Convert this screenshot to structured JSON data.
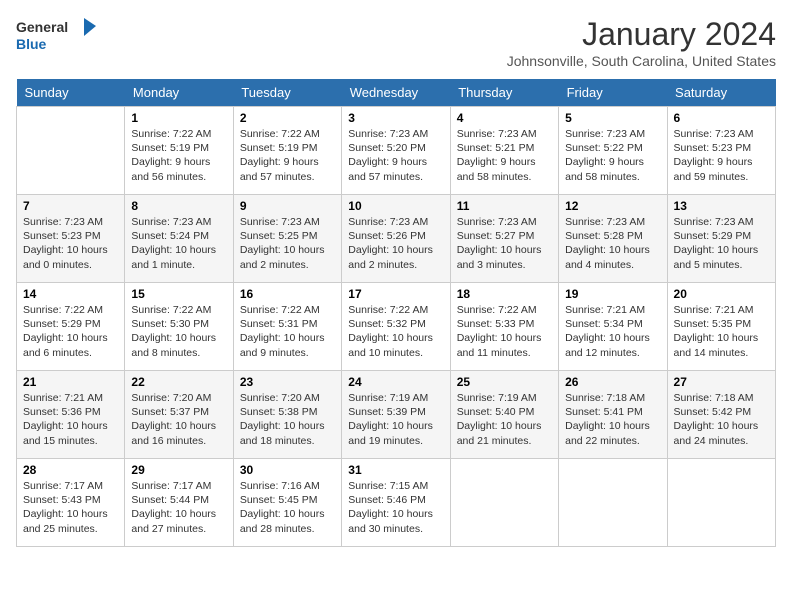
{
  "header": {
    "logo_line1": "General",
    "logo_line2": "Blue",
    "month_title": "January 2024",
    "location": "Johnsonville, South Carolina, United States"
  },
  "weekdays": [
    "Sunday",
    "Monday",
    "Tuesday",
    "Wednesday",
    "Thursday",
    "Friday",
    "Saturday"
  ],
  "weeks": [
    [
      {
        "day": "",
        "sunrise": "",
        "sunset": "",
        "daylight": ""
      },
      {
        "day": "1",
        "sunrise": "Sunrise: 7:22 AM",
        "sunset": "Sunset: 5:19 PM",
        "daylight": "Daylight: 9 hours and 56 minutes."
      },
      {
        "day": "2",
        "sunrise": "Sunrise: 7:22 AM",
        "sunset": "Sunset: 5:19 PM",
        "daylight": "Daylight: 9 hours and 57 minutes."
      },
      {
        "day": "3",
        "sunrise": "Sunrise: 7:23 AM",
        "sunset": "Sunset: 5:20 PM",
        "daylight": "Daylight: 9 hours and 57 minutes."
      },
      {
        "day": "4",
        "sunrise": "Sunrise: 7:23 AM",
        "sunset": "Sunset: 5:21 PM",
        "daylight": "Daylight: 9 hours and 58 minutes."
      },
      {
        "day": "5",
        "sunrise": "Sunrise: 7:23 AM",
        "sunset": "Sunset: 5:22 PM",
        "daylight": "Daylight: 9 hours and 58 minutes."
      },
      {
        "day": "6",
        "sunrise": "Sunrise: 7:23 AM",
        "sunset": "Sunset: 5:23 PM",
        "daylight": "Daylight: 9 hours and 59 minutes."
      }
    ],
    [
      {
        "day": "7",
        "sunrise": "Sunrise: 7:23 AM",
        "sunset": "Sunset: 5:23 PM",
        "daylight": "Daylight: 10 hours and 0 minutes."
      },
      {
        "day": "8",
        "sunrise": "Sunrise: 7:23 AM",
        "sunset": "Sunset: 5:24 PM",
        "daylight": "Daylight: 10 hours and 1 minute."
      },
      {
        "day": "9",
        "sunrise": "Sunrise: 7:23 AM",
        "sunset": "Sunset: 5:25 PM",
        "daylight": "Daylight: 10 hours and 2 minutes."
      },
      {
        "day": "10",
        "sunrise": "Sunrise: 7:23 AM",
        "sunset": "Sunset: 5:26 PM",
        "daylight": "Daylight: 10 hours and 2 minutes."
      },
      {
        "day": "11",
        "sunrise": "Sunrise: 7:23 AM",
        "sunset": "Sunset: 5:27 PM",
        "daylight": "Daylight: 10 hours and 3 minutes."
      },
      {
        "day": "12",
        "sunrise": "Sunrise: 7:23 AM",
        "sunset": "Sunset: 5:28 PM",
        "daylight": "Daylight: 10 hours and 4 minutes."
      },
      {
        "day": "13",
        "sunrise": "Sunrise: 7:23 AM",
        "sunset": "Sunset: 5:29 PM",
        "daylight": "Daylight: 10 hours and 5 minutes."
      }
    ],
    [
      {
        "day": "14",
        "sunrise": "Sunrise: 7:22 AM",
        "sunset": "Sunset: 5:29 PM",
        "daylight": "Daylight: 10 hours and 6 minutes."
      },
      {
        "day": "15",
        "sunrise": "Sunrise: 7:22 AM",
        "sunset": "Sunset: 5:30 PM",
        "daylight": "Daylight: 10 hours and 8 minutes."
      },
      {
        "day": "16",
        "sunrise": "Sunrise: 7:22 AM",
        "sunset": "Sunset: 5:31 PM",
        "daylight": "Daylight: 10 hours and 9 minutes."
      },
      {
        "day": "17",
        "sunrise": "Sunrise: 7:22 AM",
        "sunset": "Sunset: 5:32 PM",
        "daylight": "Daylight: 10 hours and 10 minutes."
      },
      {
        "day": "18",
        "sunrise": "Sunrise: 7:22 AM",
        "sunset": "Sunset: 5:33 PM",
        "daylight": "Daylight: 10 hours and 11 minutes."
      },
      {
        "day": "19",
        "sunrise": "Sunrise: 7:21 AM",
        "sunset": "Sunset: 5:34 PM",
        "daylight": "Daylight: 10 hours and 12 minutes."
      },
      {
        "day": "20",
        "sunrise": "Sunrise: 7:21 AM",
        "sunset": "Sunset: 5:35 PM",
        "daylight": "Daylight: 10 hours and 14 minutes."
      }
    ],
    [
      {
        "day": "21",
        "sunrise": "Sunrise: 7:21 AM",
        "sunset": "Sunset: 5:36 PM",
        "daylight": "Daylight: 10 hours and 15 minutes."
      },
      {
        "day": "22",
        "sunrise": "Sunrise: 7:20 AM",
        "sunset": "Sunset: 5:37 PM",
        "daylight": "Daylight: 10 hours and 16 minutes."
      },
      {
        "day": "23",
        "sunrise": "Sunrise: 7:20 AM",
        "sunset": "Sunset: 5:38 PM",
        "daylight": "Daylight: 10 hours and 18 minutes."
      },
      {
        "day": "24",
        "sunrise": "Sunrise: 7:19 AM",
        "sunset": "Sunset: 5:39 PM",
        "daylight": "Daylight: 10 hours and 19 minutes."
      },
      {
        "day": "25",
        "sunrise": "Sunrise: 7:19 AM",
        "sunset": "Sunset: 5:40 PM",
        "daylight": "Daylight: 10 hours and 21 minutes."
      },
      {
        "day": "26",
        "sunrise": "Sunrise: 7:18 AM",
        "sunset": "Sunset: 5:41 PM",
        "daylight": "Daylight: 10 hours and 22 minutes."
      },
      {
        "day": "27",
        "sunrise": "Sunrise: 7:18 AM",
        "sunset": "Sunset: 5:42 PM",
        "daylight": "Daylight: 10 hours and 24 minutes."
      }
    ],
    [
      {
        "day": "28",
        "sunrise": "Sunrise: 7:17 AM",
        "sunset": "Sunset: 5:43 PM",
        "daylight": "Daylight: 10 hours and 25 minutes."
      },
      {
        "day": "29",
        "sunrise": "Sunrise: 7:17 AM",
        "sunset": "Sunset: 5:44 PM",
        "daylight": "Daylight: 10 hours and 27 minutes."
      },
      {
        "day": "30",
        "sunrise": "Sunrise: 7:16 AM",
        "sunset": "Sunset: 5:45 PM",
        "daylight": "Daylight: 10 hours and 28 minutes."
      },
      {
        "day": "31",
        "sunrise": "Sunrise: 7:15 AM",
        "sunset": "Sunset: 5:46 PM",
        "daylight": "Daylight: 10 hours and 30 minutes."
      },
      {
        "day": "",
        "sunrise": "",
        "sunset": "",
        "daylight": ""
      },
      {
        "day": "",
        "sunrise": "",
        "sunset": "",
        "daylight": ""
      },
      {
        "day": "",
        "sunrise": "",
        "sunset": "",
        "daylight": ""
      }
    ]
  ]
}
